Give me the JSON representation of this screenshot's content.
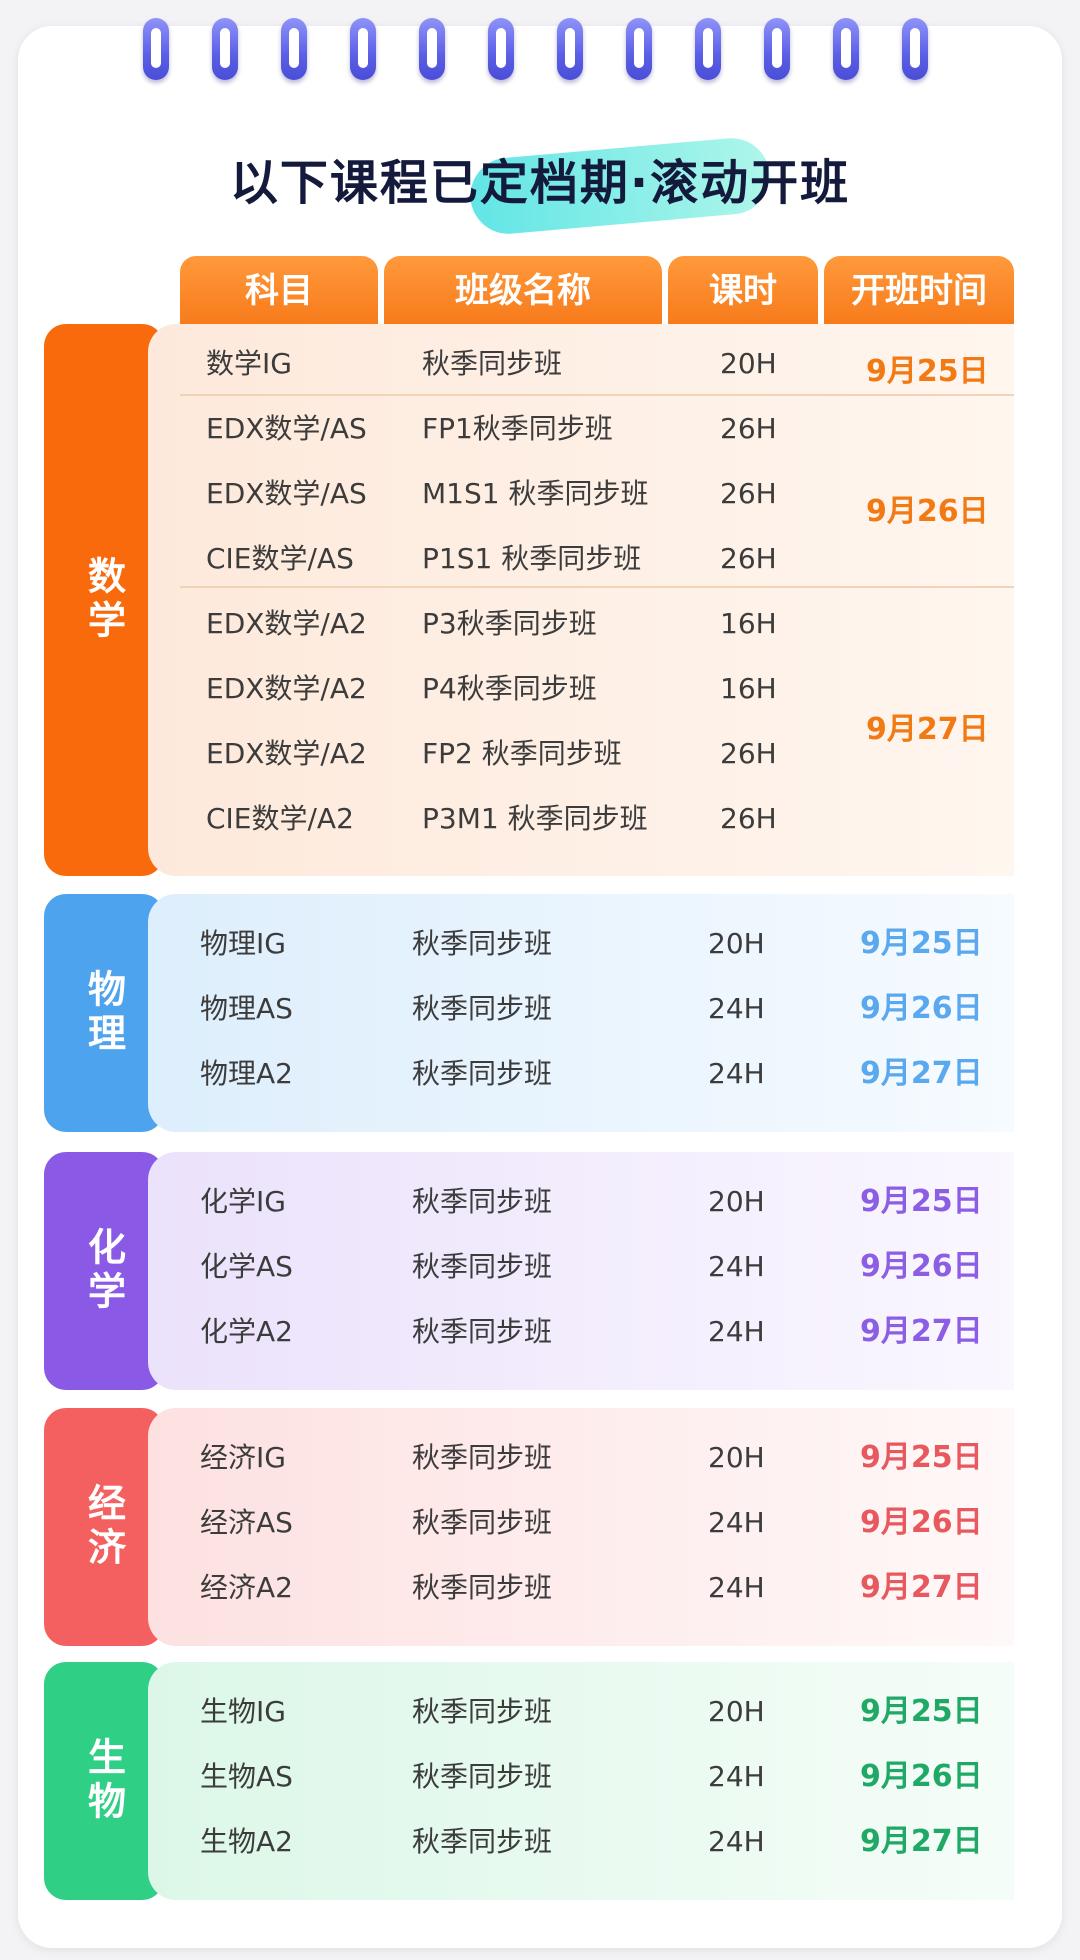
{
  "title": "以下课程已定档期·滚动开班",
  "headers": [
    "科目",
    "班级名称",
    "课时",
    "开班时间"
  ],
  "math": {
    "label": "数学",
    "color": "#f96a0c",
    "panel_color": "#fdeee3",
    "date_color": "#f17a14",
    "rows": [
      {
        "subject": "数学IG",
        "class": "秋季同步班",
        "hours": "20H"
      },
      {
        "subject": "EDX数学/AS",
        "class": "FP1秋季同步班",
        "hours": "26H"
      },
      {
        "subject": "EDX数学/AS",
        "class": "M1S1 秋季同步班",
        "hours": "26H"
      },
      {
        "subject": "CIE数学/AS",
        "class": "P1S1 秋季同步班",
        "hours": "26H"
      },
      {
        "subject": "EDX数学/A2",
        "class": "P3秋季同步班",
        "hours": "16H"
      },
      {
        "subject": "EDX数学/A2",
        "class": "P4秋季同步班",
        "hours": "16H"
      },
      {
        "subject": "EDX数学/A2",
        "class": "FP2 秋季同步班",
        "hours": "26H"
      },
      {
        "subject": "CIE数学/A2",
        "class": "P3M1 秋季同步班",
        "hours": "26H"
      }
    ],
    "dates": [
      "9月25日",
      "9月26日",
      "9月27日"
    ]
  },
  "physics": {
    "label": "物理",
    "color": "#4ea3ef",
    "panel_color": "#e4f1fd",
    "date_color": "#5aa8ee",
    "rows": [
      {
        "subject": "物理IG",
        "class": "秋季同步班",
        "hours": "20H",
        "date": "9月25日"
      },
      {
        "subject": "物理AS",
        "class": "秋季同步班",
        "hours": "24H",
        "date": "9月26日"
      },
      {
        "subject": "物理A2",
        "class": "秋季同步班",
        "hours": "24H",
        "date": "9月27日"
      }
    ]
  },
  "chemistry": {
    "label": "化学",
    "color": "#8a5ae6",
    "panel_color": "#efe8fc",
    "date_color": "#8c5ee4",
    "rows": [
      {
        "subject": "化学IG",
        "class": "秋季同步班",
        "hours": "20H",
        "date": "9月25日"
      },
      {
        "subject": "化学AS",
        "class": "秋季同步班",
        "hours": "24H",
        "date": "9月26日"
      },
      {
        "subject": "化学A2",
        "class": "秋季同步班",
        "hours": "24H",
        "date": "9月27日"
      }
    ]
  },
  "economics": {
    "label": "经济",
    "color": "#f46060",
    "panel_color": "#fde7e7",
    "date_color": "#e8585f",
    "rows": [
      {
        "subject": "经济IG",
        "class": "秋季同步班",
        "hours": "20H",
        "date": "9月25日"
      },
      {
        "subject": "经济AS",
        "class": "秋季同步班",
        "hours": "24H",
        "date": "9月26日"
      },
      {
        "subject": "经济A2",
        "class": "秋季同步班",
        "hours": "24H",
        "date": "9月27日"
      }
    ]
  },
  "biology": {
    "label": "生物",
    "color": "#2fcf85",
    "panel_color": "#e2f8ec",
    "date_color": "#1fa866",
    "rows": [
      {
        "subject": "生物IG",
        "class": "秋季同步班",
        "hours": "20H",
        "date": "9月25日"
      },
      {
        "subject": "生物AS",
        "class": "秋季同步班",
        "hours": "24H",
        "date": "9月26日"
      },
      {
        "subject": "生物A2",
        "class": "秋季同步班",
        "hours": "24H",
        "date": "9月27日"
      }
    ]
  }
}
